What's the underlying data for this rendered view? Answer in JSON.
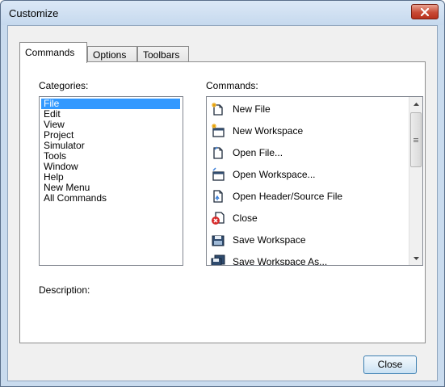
{
  "window": {
    "title": "Customize"
  },
  "tabs": [
    {
      "label": "Commands"
    },
    {
      "label": "Options"
    },
    {
      "label": "Toolbars"
    }
  ],
  "categories": {
    "label": "Categories:",
    "selected": "File",
    "items": [
      "File",
      "Edit",
      "View",
      "Project",
      "Simulator",
      "Tools",
      "Window",
      "Help",
      "New Menu",
      "All Commands"
    ]
  },
  "commands": {
    "label": "Commands:",
    "items": [
      {
        "label": "New File",
        "icon": "new-file-icon"
      },
      {
        "label": "New Workspace",
        "icon": "new-workspace-icon"
      },
      {
        "label": "Open File...",
        "icon": "open-file-icon"
      },
      {
        "label": "Open Workspace...",
        "icon": "open-workspace-icon"
      },
      {
        "label": "Open Header/Source File",
        "icon": "open-header-source-icon"
      },
      {
        "label": "Close",
        "icon": "close-file-icon"
      },
      {
        "label": "Save Workspace",
        "icon": "save-workspace-icon"
      },
      {
        "label": "Save Workspace As...",
        "icon": "save-workspace-as-icon"
      }
    ]
  },
  "description": {
    "label": "Description:"
  },
  "buttons": {
    "close": "Close"
  },
  "colors": {
    "selection": "#3399ff",
    "title_close": "#c84b36"
  }
}
